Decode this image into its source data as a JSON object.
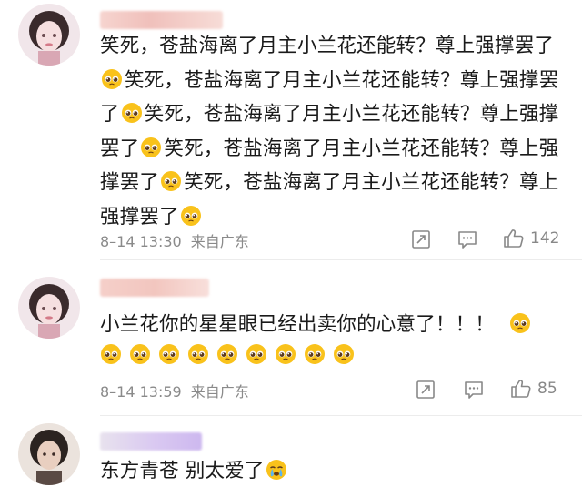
{
  "comments": [
    {
      "text_segments": [
        "笑死，苍盐海离了月主小兰花还能转？尊上强撑罢了",
        "笑死，苍盐海离了月主小兰花还能转？尊上强撑罢了",
        "笑死，苍盐海离了月主小兰花还能转？尊上强撑罢了",
        "笑死，苍盐海离了月主小兰花还能转？尊上强撑罢了",
        "笑死，苍盐海离了月主小兰花还能转？尊上强撑罢了"
      ],
      "emoji": "pleading-face",
      "date": "8–14 13:30",
      "location": "来自广东",
      "like_count": "142"
    },
    {
      "text": "小兰花你的星星眼已经出卖你的心意了！！！",
      "emoji": "pleading-face",
      "emoji_row_count": 9,
      "date": "8–14 13:59",
      "location": "来自广东",
      "like_count": "85"
    },
    {
      "text": "东方青苍 别太爱了",
      "emoji": "crying-face"
    }
  ],
  "colors": {
    "meta_text": "#8a8a8a",
    "emoji_yellow": "#f9c21b",
    "username_blur": "#f3c9c4",
    "username_blur_alt": "#d8c6f0"
  }
}
